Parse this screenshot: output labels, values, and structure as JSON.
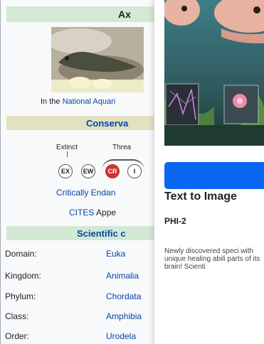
{
  "infobox": {
    "title": "Ax",
    "caption_prefix": "In the",
    "caption_link": "National Aquari",
    "conservation_header": "Conserva",
    "status_scale": {
      "extinct_label": "Extinct",
      "threatened_label": "Threa",
      "codes": [
        "EX",
        "EW",
        "CR",
        "I"
      ],
      "highlighted": "CR"
    },
    "status_name": "Critically Endan",
    "cites_link": "CITES",
    "cites_rest": "Appe",
    "scientific_header": "Scientific c",
    "taxonomy": [
      {
        "rank": "Domain:",
        "value": "Euka"
      },
      {
        "rank": "Kingdom:",
        "value": "Animalia"
      },
      {
        "rank": "Phylum:",
        "value": "Chordata"
      },
      {
        "rank": "Class:",
        "value": "Amphibia"
      },
      {
        "rank": "Order:",
        "value": "Urodela"
      }
    ]
  },
  "card": {
    "title": "Text to Image",
    "subtitle": "PHI-2",
    "description": "Newly discovered speci with unique healing abili parts of its brain! Scienti"
  },
  "colors": {
    "link": "#0645ad",
    "cr_red": "#cc3333",
    "button_blue": "#0b66f2",
    "conservation_band": "#e2e1c0",
    "title_band": "#d3e9d3"
  }
}
